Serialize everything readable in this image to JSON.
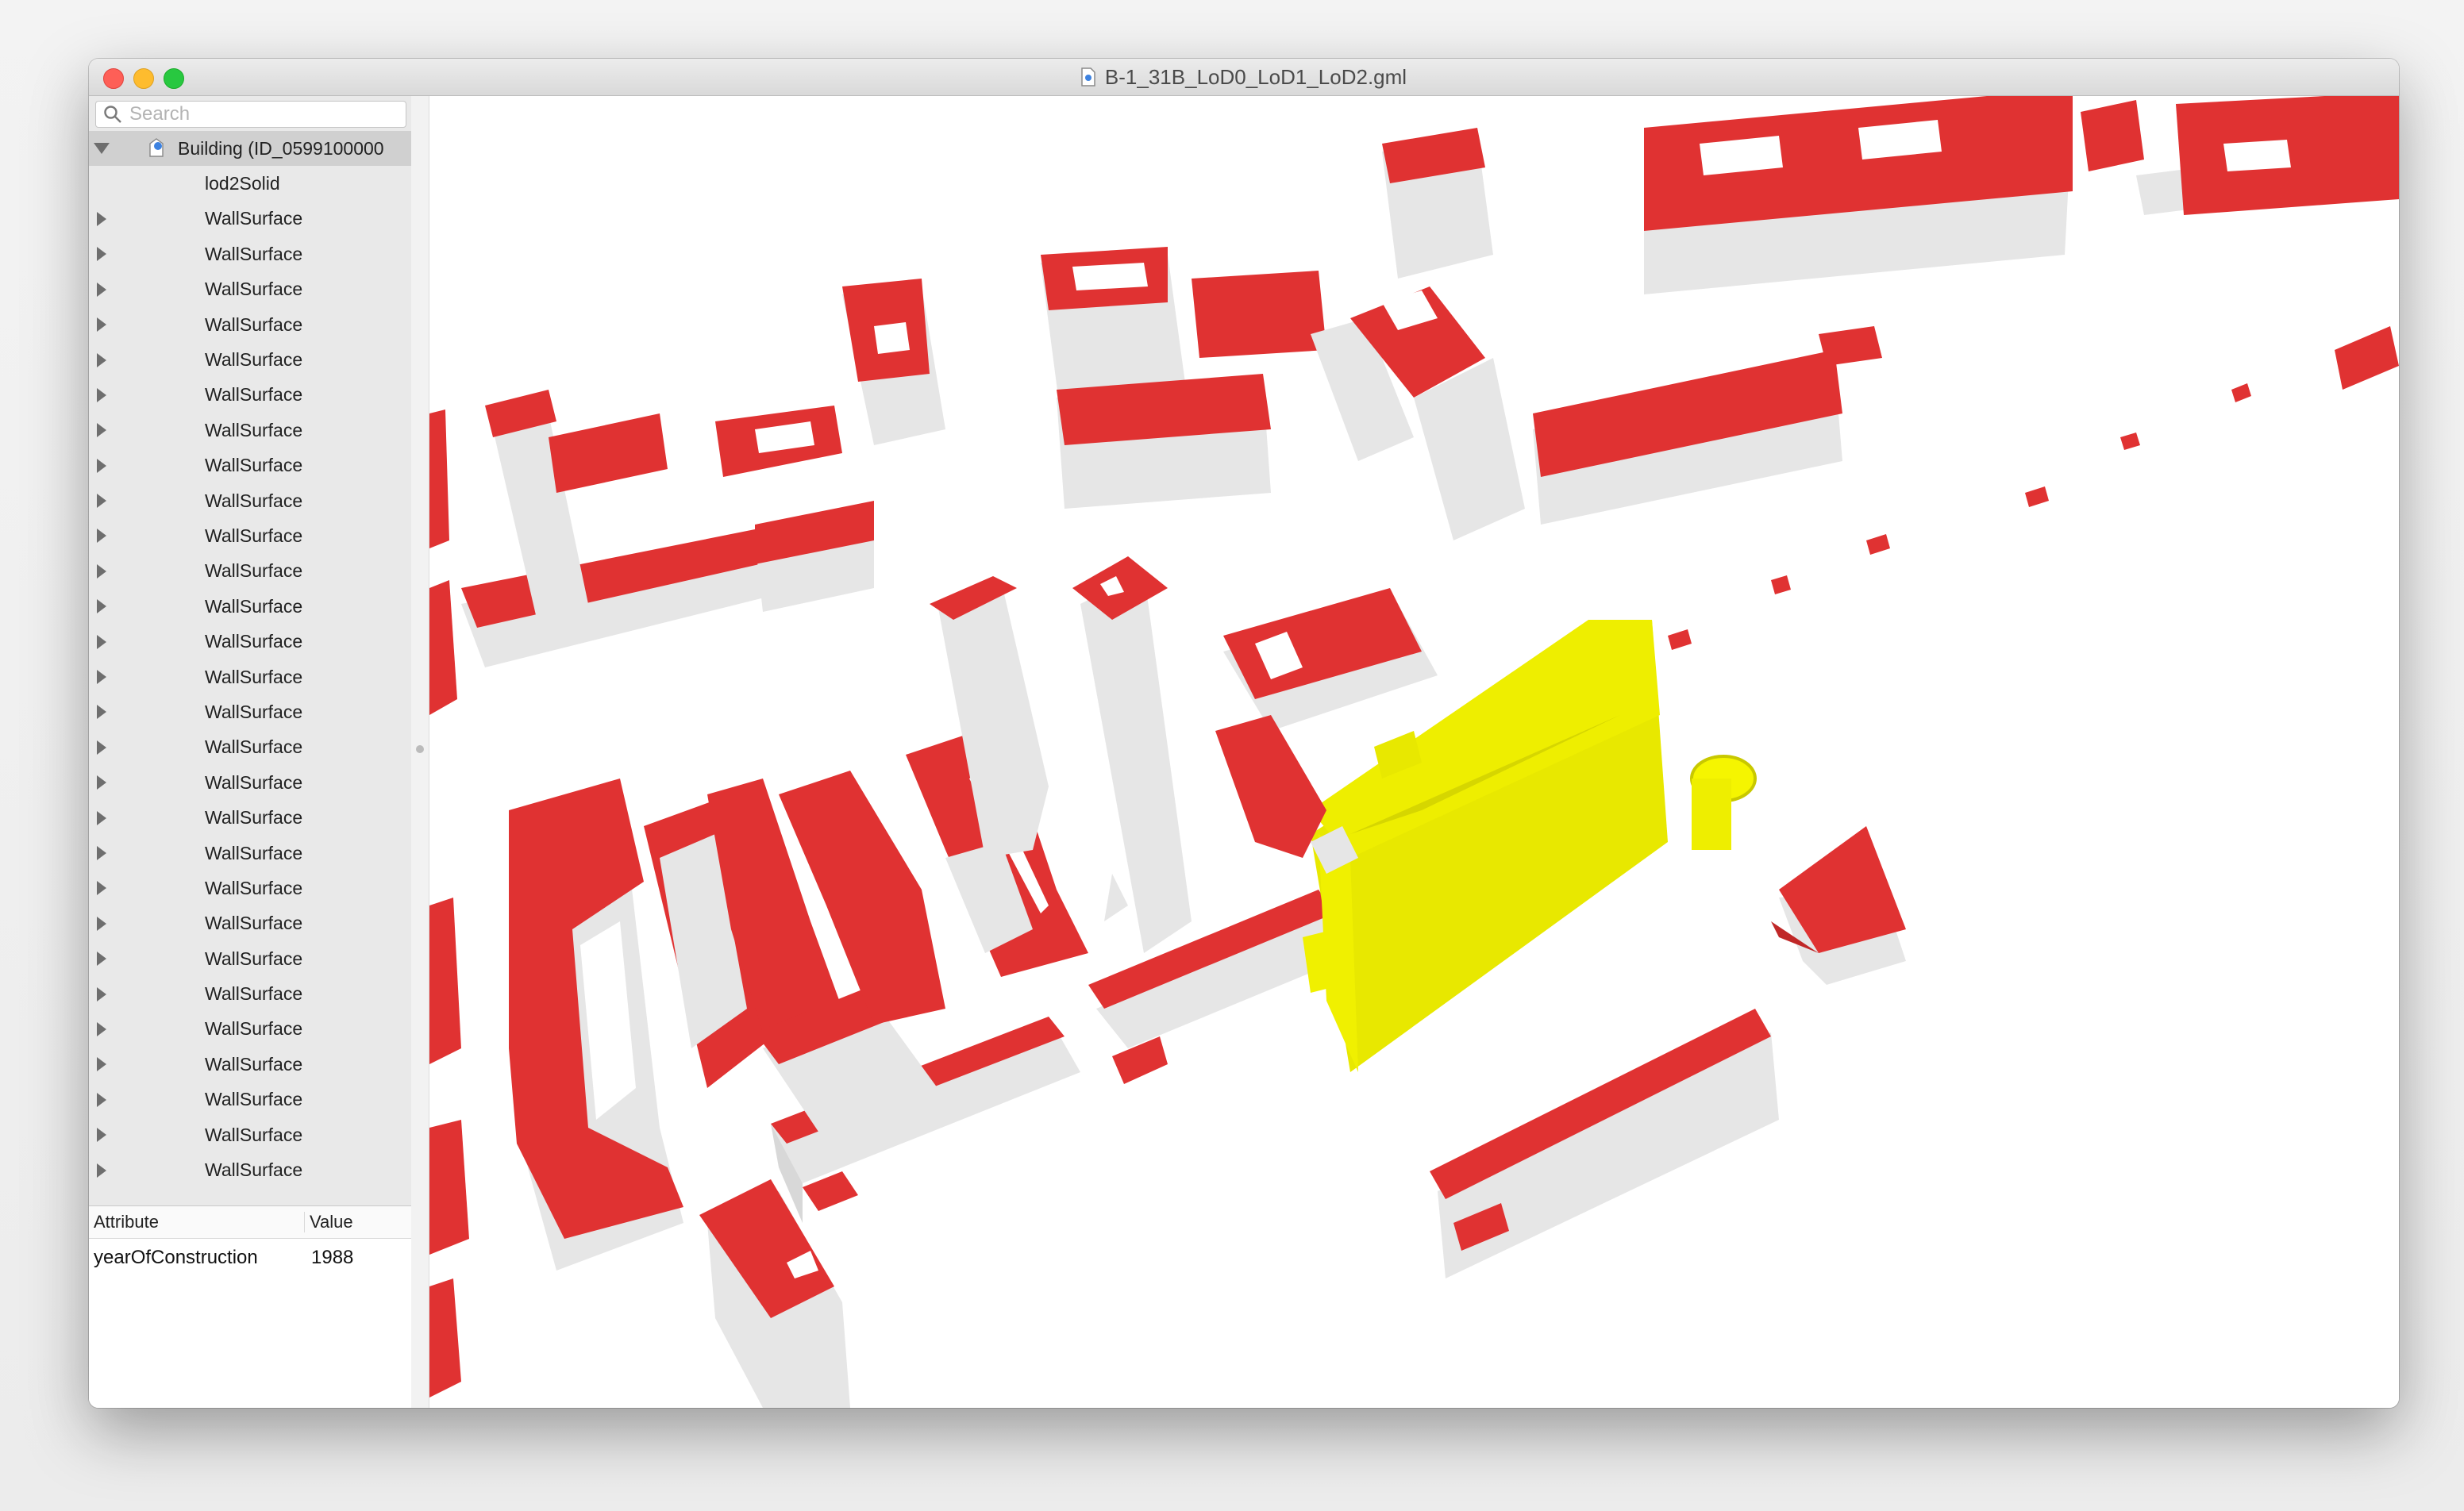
{
  "window": {
    "title": "B-1_31B_LoD0_LoD1_LoD2.gml"
  },
  "search": {
    "placeholder": "Search",
    "value": ""
  },
  "tree": {
    "root_label": "Building (ID_0599100000",
    "root_expanded": true,
    "children": [
      {
        "label": "lod2Solid",
        "expandable": false
      },
      {
        "label": "WallSurface",
        "expandable": true
      },
      {
        "label": "WallSurface",
        "expandable": true
      },
      {
        "label": "WallSurface",
        "expandable": true
      },
      {
        "label": "WallSurface",
        "expandable": true
      },
      {
        "label": "WallSurface",
        "expandable": true
      },
      {
        "label": "WallSurface",
        "expandable": true
      },
      {
        "label": "WallSurface",
        "expandable": true
      },
      {
        "label": "WallSurface",
        "expandable": true
      },
      {
        "label": "WallSurface",
        "expandable": true
      },
      {
        "label": "WallSurface",
        "expandable": true
      },
      {
        "label": "WallSurface",
        "expandable": true
      },
      {
        "label": "WallSurface",
        "expandable": true
      },
      {
        "label": "WallSurface",
        "expandable": true
      },
      {
        "label": "WallSurface",
        "expandable": true
      },
      {
        "label": "WallSurface",
        "expandable": true
      },
      {
        "label": "WallSurface",
        "expandable": true
      },
      {
        "label": "WallSurface",
        "expandable": true
      },
      {
        "label": "WallSurface",
        "expandable": true
      },
      {
        "label": "WallSurface",
        "expandable": true
      },
      {
        "label": "WallSurface",
        "expandable": true
      },
      {
        "label": "WallSurface",
        "expandable": true
      },
      {
        "label": "WallSurface",
        "expandable": true
      },
      {
        "label": "WallSurface",
        "expandable": true
      },
      {
        "label": "WallSurface",
        "expandable": true
      },
      {
        "label": "WallSurface",
        "expandable": true
      },
      {
        "label": "WallSurface",
        "expandable": true
      },
      {
        "label": "WallSurface",
        "expandable": true
      },
      {
        "label": "WallSurface",
        "expandable": true
      }
    ]
  },
  "attributes": {
    "header_attribute": "Attribute",
    "header_value": "Value",
    "rows": [
      {
        "attribute": "yearOfConstruction",
        "value": "1988"
      }
    ]
  },
  "icons": {
    "search": "search-icon",
    "document": "gml-document-icon",
    "building": "building-icon",
    "disclosure_collapsed": "disclosure-right-icon",
    "disclosure_expanded": "disclosure-down-icon"
  },
  "colors": {
    "roof": "#e03232",
    "wall": "#e6e6e6",
    "selected_building": "#f2f200",
    "close": "#fe5f57",
    "minimize": "#febc2e",
    "maximize": "#28c840"
  }
}
